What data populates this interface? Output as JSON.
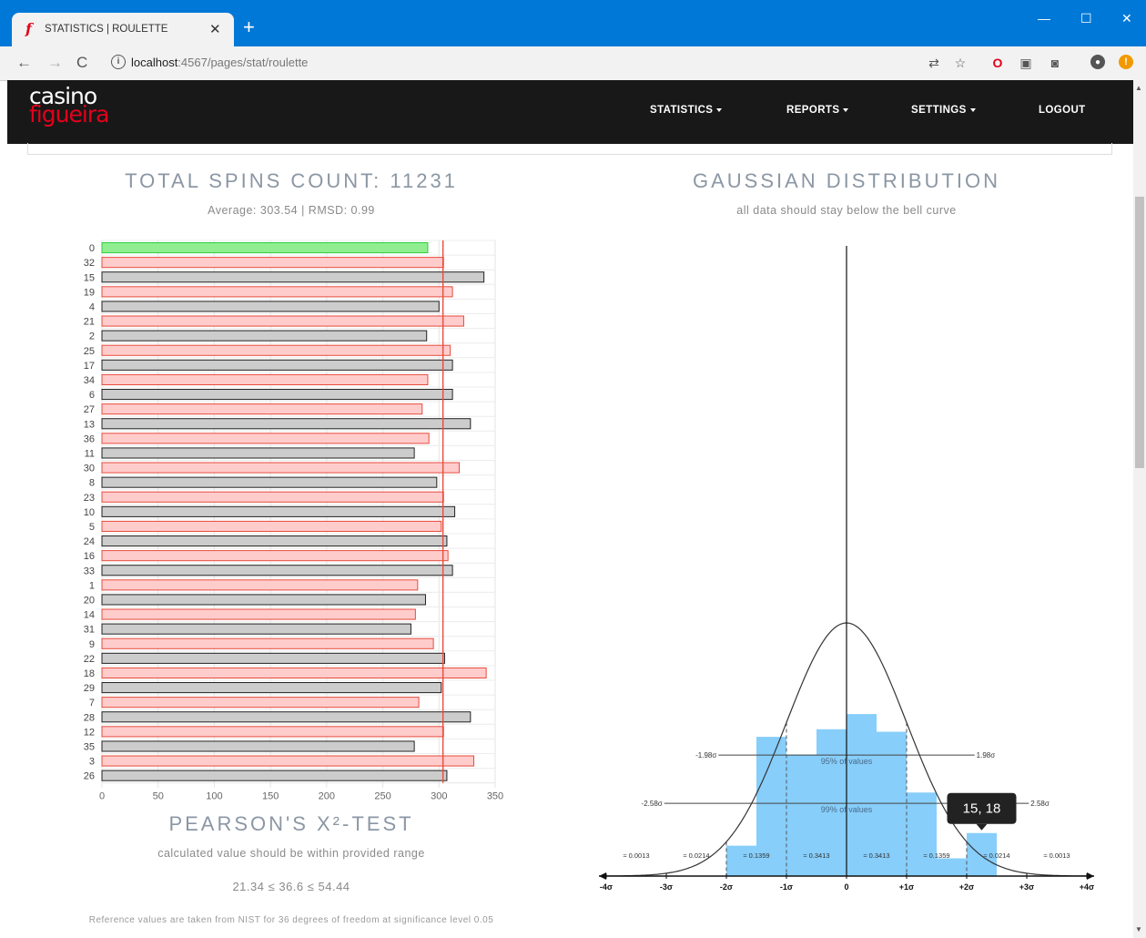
{
  "browser": {
    "tab_title": "STATISTICS | ROULETTE",
    "tab_close": "✕",
    "new_tab": "+",
    "url_host": "localhost",
    "url_path": ":4567/pages/stat/roulette",
    "window_controls": [
      "—",
      "☐",
      "✕"
    ]
  },
  "site": {
    "logo_top": "casino",
    "logo_bottom": "figueira",
    "nav": [
      "STATISTICS",
      "REPORTS",
      "SETTINGS",
      "LOGOUT"
    ]
  },
  "spins": {
    "title": "TOTAL SPINS COUNT: 11231",
    "subtitle": "Average: 303.54 | RMSD: 0.99"
  },
  "gauss": {
    "title": "GAUSSIAN DISTRIBUTION",
    "subtitle": "all data should stay below the bell curve"
  },
  "pearson": {
    "title": "PEARSON'S X²-TEST",
    "subtitle": "calculated value should be within provided range",
    "range": "21.34 ≤ 36.6 ≤ 54.44",
    "note": "Reference values are taken from NIST for 36 degrees of freedom at significance level 0.05"
  },
  "colors": {
    "green": "#90ee90",
    "red": "#ffcccc",
    "black": "#cccccc",
    "avg_line": "#e74c3c",
    "hist": "#87cefa"
  },
  "chart_data": [
    {
      "type": "bar",
      "orientation": "horizontal",
      "categories": [
        "0",
        "32",
        "15",
        "19",
        "4",
        "21",
        "2",
        "25",
        "17",
        "34",
        "6",
        "27",
        "13",
        "36",
        "11",
        "30",
        "8",
        "23",
        "10",
        "5",
        "24",
        "16",
        "33",
        "1",
        "20",
        "14",
        "31",
        "9",
        "22",
        "18",
        "29",
        "7",
        "28",
        "12",
        "35",
        "3",
        "26"
      ],
      "values": [
        290,
        304,
        340,
        312,
        300,
        322,
        289,
        310,
        312,
        290,
        312,
        285,
        328,
        291,
        278,
        318,
        298,
        304,
        314,
        302,
        307,
        308,
        312,
        281,
        288,
        279,
        275,
        295,
        305,
        342,
        302,
        282,
        328,
        304,
        278,
        331,
        307
      ],
      "pocket_colors": [
        "green",
        "red",
        "black",
        "red",
        "black",
        "red",
        "black",
        "red",
        "black",
        "red",
        "black",
        "red",
        "black",
        "red",
        "black",
        "red",
        "black",
        "red",
        "black",
        "red",
        "black",
        "red",
        "black",
        "red",
        "black",
        "red",
        "black",
        "red",
        "black",
        "red",
        "black",
        "red",
        "black",
        "red",
        "black",
        "red",
        "black"
      ],
      "reference_line": 303.54,
      "xlim": [
        0,
        350
      ],
      "xticks": [
        0,
        50,
        100,
        150,
        200,
        250,
        300,
        350
      ],
      "grid": true
    },
    {
      "type": "bar",
      "subtype": "histogram with normal curve",
      "x_tick_labels": [
        "-4σ",
        "-3σ",
        "-2σ",
        "-1σ",
        "0",
        "+1σ",
        "+2σ",
        "+3σ",
        "+4σ"
      ],
      "bins": [
        {
          "from": -2.0,
          "to": -1.5,
          "value": 0.12
        },
        {
          "from": -1.5,
          "to": -1.0,
          "value": 0.55
        },
        {
          "from": -1.0,
          "to": -0.5,
          "value": 0.48
        },
        {
          "from": -0.5,
          "to": 0.0,
          "value": 0.58
        },
        {
          "from": 0.0,
          "to": 0.5,
          "value": 0.64
        },
        {
          "from": 0.5,
          "to": 1.0,
          "value": 0.57
        },
        {
          "from": 1.0,
          "to": 1.5,
          "value": 0.33
        },
        {
          "from": 1.5,
          "to": 2.0,
          "value": 0.07
        },
        {
          "from": 2.0,
          "to": 2.5,
          "value": 0.17
        }
      ],
      "area_labels": [
        "≈ 0.0013",
        "≈ 0.0214",
        "≈ 0.1359",
        "≈ 0.3413",
        "≈ 0.3413",
        "≈ 0.1359",
        "≈ 0.0214",
        "≈ 0.0013"
      ],
      "bands": [
        {
          "left": "-1.98σ",
          "right": "1.98σ",
          "label": "95% of values"
        },
        {
          "left": "-2.58σ",
          "right": "2.58σ",
          "label": "99% of values"
        }
      ],
      "tooltip": "15, 18"
    }
  ]
}
